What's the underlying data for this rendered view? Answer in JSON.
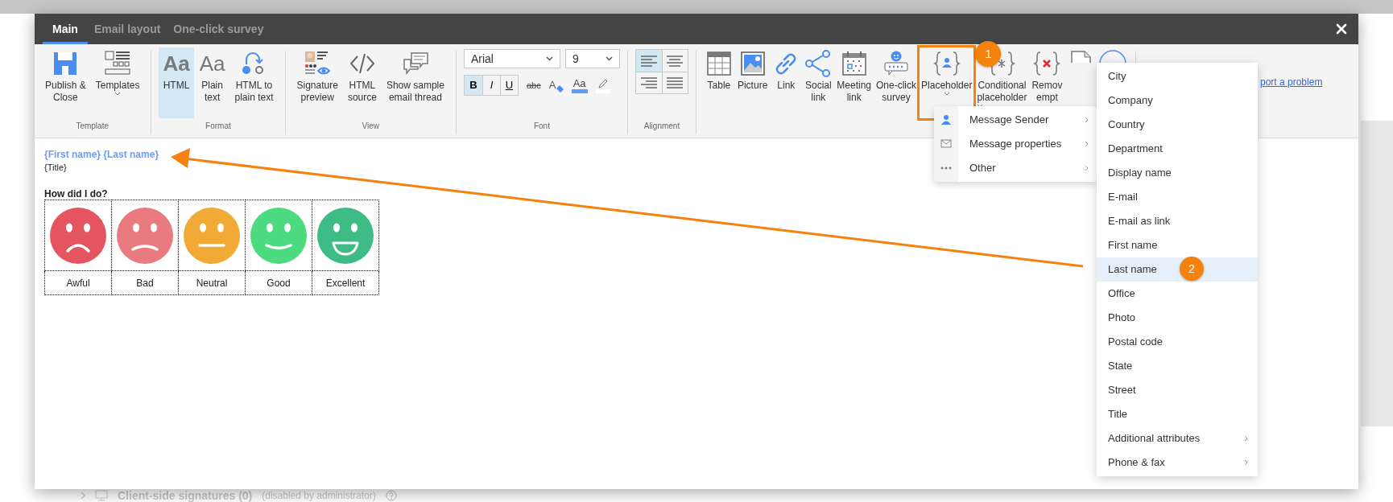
{
  "tabs": [
    {
      "label": "Main",
      "selected": true
    },
    {
      "label": "Email layout",
      "selected": false
    },
    {
      "label": "One-click survey",
      "selected": false
    }
  ],
  "ribbon": {
    "groups": [
      {
        "kind": "buttons",
        "label": "Template",
        "buttons": [
          {
            "label": "Publish &\nClose",
            "selected": false,
            "has_menu": false
          },
          {
            "label": "Templates",
            "selected": false,
            "has_menu": true
          }
        ]
      },
      {
        "kind": "buttons",
        "label": "Format",
        "buttons": [
          {
            "label": "HTML",
            "glyph": "Aa",
            "selected": true,
            "has_menu": false
          },
          {
            "label": "Plain\ntext",
            "glyph": "Aa",
            "selected": false,
            "has_menu": false
          },
          {
            "label": "HTML to\nplain text",
            "selected": false,
            "has_menu": false
          }
        ]
      },
      {
        "kind": "buttons",
        "label": "View",
        "buttons": [
          {
            "label": "Signature\npreview",
            "selected": false,
            "has_menu": false
          },
          {
            "label": "HTML\nsource",
            "selected": false,
            "has_menu": false
          },
          {
            "label": "Show sample\nemail thread",
            "selected": false,
            "has_menu": false
          }
        ]
      },
      {
        "kind": "font",
        "label": "Font",
        "font_family": "Arial",
        "font_size": "9",
        "styles": [
          {
            "label": "B",
            "selected": true
          },
          {
            "label": "I",
            "selected": false
          },
          {
            "label": "U",
            "selected": false
          }
        ],
        "strikethrough": "abc",
        "clear_formatting": "A",
        "font_color": "Aa"
      },
      {
        "kind": "alignment",
        "label": "Alignment",
        "options": [
          {
            "selected": true
          },
          {
            "selected": false
          },
          {
            "selected": false
          },
          {
            "selected": false
          }
        ]
      },
      {
        "kind": "insert",
        "buttons": [
          {
            "label": "Table",
            "has_menu": false,
            "outlined": false
          },
          {
            "label": "Picture",
            "has_menu": false,
            "outlined": false
          },
          {
            "label": "Link",
            "has_menu": false,
            "outlined": false
          },
          {
            "label": "Social\nlink",
            "has_menu": false,
            "outlined": false
          },
          {
            "label": "Meeting\nlink",
            "has_menu": false,
            "outlined": false
          },
          {
            "label": "One-click\nsurvey",
            "has_menu": false,
            "outlined": false
          },
          {
            "label": "Placeholder",
            "has_menu": true,
            "outlined": true,
            "callout": "1"
          },
          {
            "label": "Conditional\nplaceholder",
            "has_menu": true,
            "outlined": false
          },
          {
            "label": "Remov\nempt",
            "has_menu": false,
            "outlined": false
          },
          {
            "has_menu": false,
            "outlined": false
          },
          {
            "has_menu": false,
            "outlined": false
          }
        ]
      }
    ],
    "link": "port a problem"
  },
  "editor": {
    "name_line": "{First name} {Last name}",
    "title_line": "{Title}",
    "survey_heading": "How did I do?",
    "survey_options": [
      {
        "label": "Awful",
        "kind": "frown",
        "color": "#e5555f"
      },
      {
        "label": "Bad",
        "kind": "slight-frown",
        "color": "#e87a80"
      },
      {
        "label": "Neutral",
        "kind": "neutral",
        "color": "#f2aa36"
      },
      {
        "label": "Good",
        "kind": "smile",
        "color": "#4ddb82"
      },
      {
        "label": "Excellent",
        "kind": "grin",
        "color": "#3fbb85"
      }
    ]
  },
  "placeholder_menu": {
    "items": [
      {
        "label": "Message Sender"
      },
      {
        "label": "Message properties"
      },
      {
        "label": "Other"
      }
    ]
  },
  "sender_submenu": {
    "items": [
      {
        "label": "City",
        "selected": false,
        "has_submenu": false
      },
      {
        "label": "Company",
        "selected": false,
        "has_submenu": false
      },
      {
        "label": "Country",
        "selected": false,
        "has_submenu": false
      },
      {
        "label": "Department",
        "selected": false,
        "has_submenu": false
      },
      {
        "label": "Display name",
        "selected": false,
        "has_submenu": false
      },
      {
        "label": "E-mail",
        "selected": false,
        "has_submenu": false
      },
      {
        "label": "E-mail as link",
        "selected": false,
        "has_submenu": false
      },
      {
        "label": "First name",
        "selected": false,
        "has_submenu": false
      },
      {
        "label": "Last name",
        "selected": true,
        "has_submenu": false,
        "callout": "2"
      },
      {
        "label": "Office",
        "selected": false,
        "has_submenu": false
      },
      {
        "label": "Photo",
        "selected": false,
        "has_submenu": false
      },
      {
        "label": "Postal code",
        "selected": false,
        "has_submenu": false
      },
      {
        "label": "State",
        "selected": false,
        "has_submenu": false
      },
      {
        "label": "Street",
        "selected": false,
        "has_submenu": false
      },
      {
        "label": "Title",
        "selected": false,
        "has_submenu": false
      },
      {
        "label": "Additional attributes",
        "selected": false,
        "has_submenu": true
      },
      {
        "label": "Phone & fax",
        "selected": false,
        "has_submenu": true
      }
    ]
  },
  "background": {
    "section_title": "Client-side signatures (0)",
    "section_note": "(disabled by administrator)"
  }
}
